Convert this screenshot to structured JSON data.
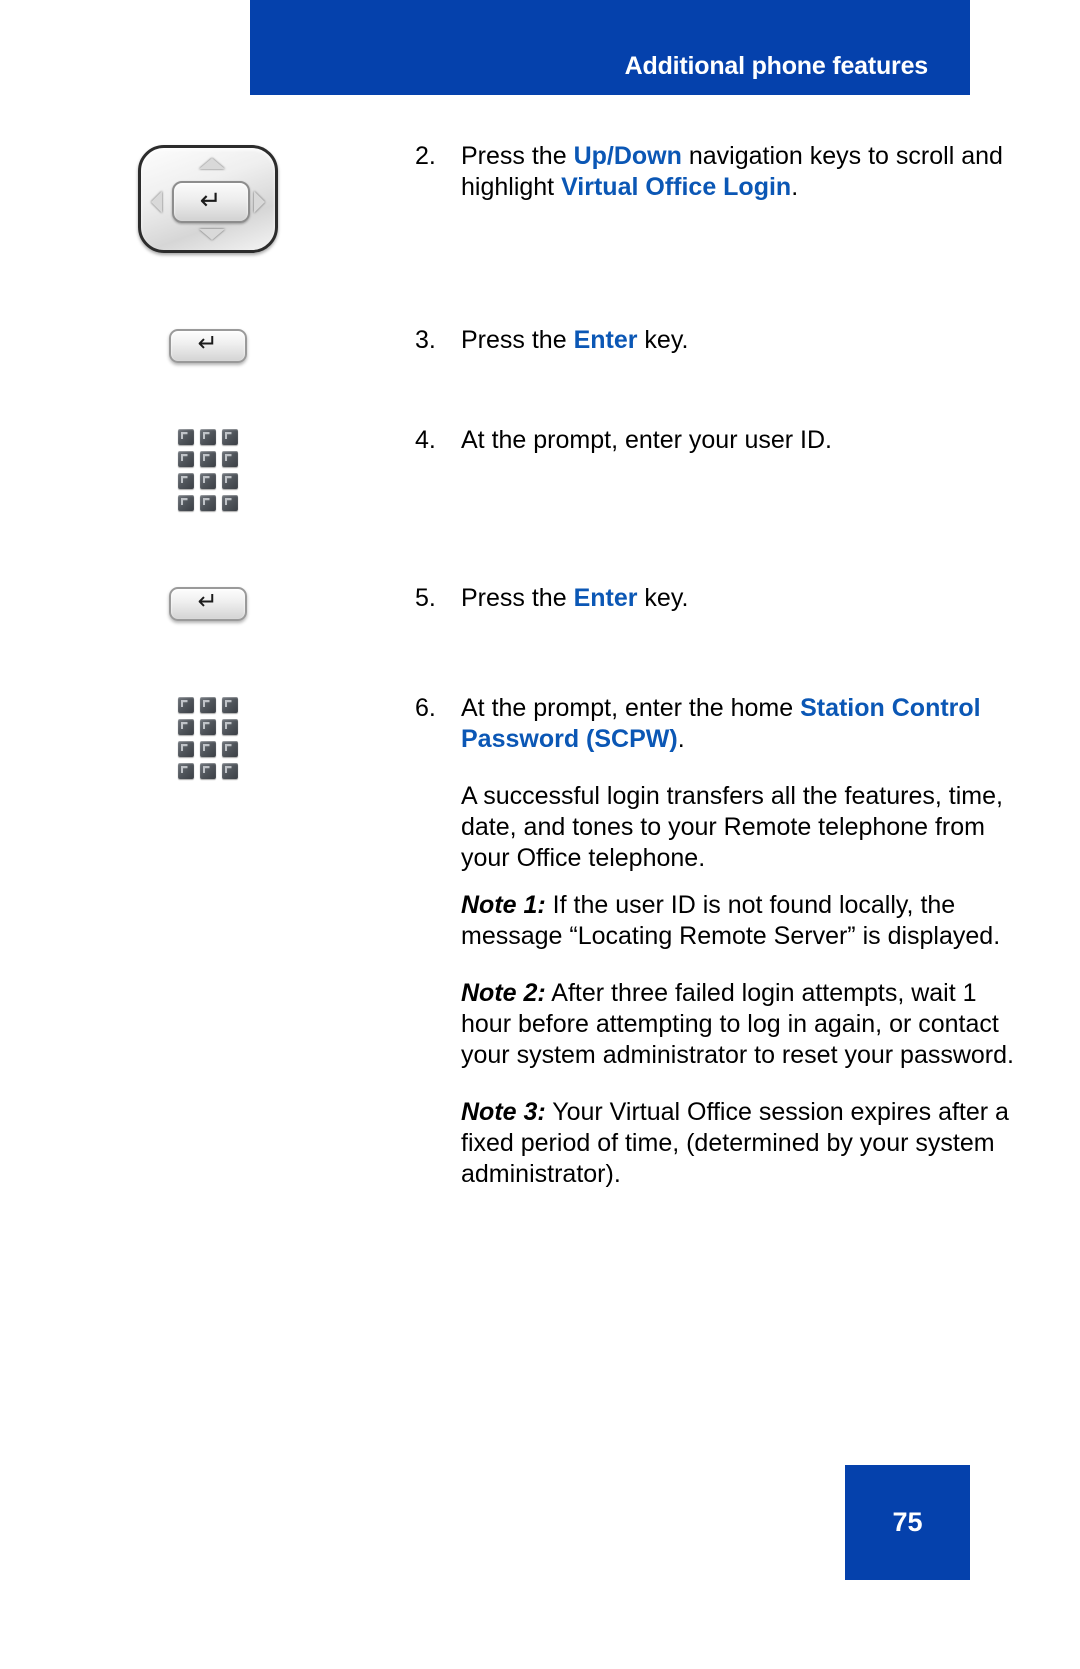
{
  "header": {
    "title": "Additional phone features",
    "banner_color": "#0541ac"
  },
  "accent_color": "#0b57b5",
  "steps": [
    {
      "number": "2.",
      "icon": "navigation-cluster-icon",
      "text_parts": [
        {
          "t": "Press the ",
          "style": "normal"
        },
        {
          "t": "Up/Down",
          "style": "blue-bold"
        },
        {
          "t": " navigation keys to scroll and highlight ",
          "style": "normal"
        },
        {
          "t": "Virtual Office Login",
          "style": "blue-bold"
        },
        {
          "t": ".",
          "style": "normal"
        }
      ],
      "line1_plain": "Press the ",
      "line1_blue": "Up/Down",
      "line1_tail": " navigation keys to",
      "line2_plain": "scroll and highlight ",
      "line2_blue": "Virtual Office Login",
      "line2_tail": "."
    },
    {
      "number": "3.",
      "icon": "enter-key-icon",
      "prefix": "Press the ",
      "blue": "Enter",
      "suffix": " key."
    },
    {
      "number": "4.",
      "icon": "keypad-icon",
      "plain": "At the prompt, enter your user ID."
    },
    {
      "number": "5.",
      "icon": "enter-key-icon",
      "prefix": "Press the ",
      "blue": "Enter",
      "suffix": " key."
    },
    {
      "number": "6.",
      "icon": "keypad-icon",
      "prefix": "At the prompt, enter the home ",
      "blue": "Station Control Password (SCPW)",
      "suffix": "."
    }
  ],
  "body": {
    "success_paragraph": "A successful login transfers all the features, time, date, and tones to your Remote telephone from your Office telephone.",
    "notes": [
      {
        "label": "Note 1:",
        "text": " If the user ID is not found locally, the message “Locating Remote Server” is displayed."
      },
      {
        "label": "Note 2:",
        "text": " After three failed login attempts, wait 1 hour before attempting to log in again, or contact your system administrator to reset your password."
      },
      {
        "label": "Note 3:",
        "text": " Your Virtual Office session expires after a fixed period of time, (determined by your system administrator)."
      }
    ]
  },
  "footer": {
    "page_number": "75",
    "block_color": "#0541ac"
  }
}
